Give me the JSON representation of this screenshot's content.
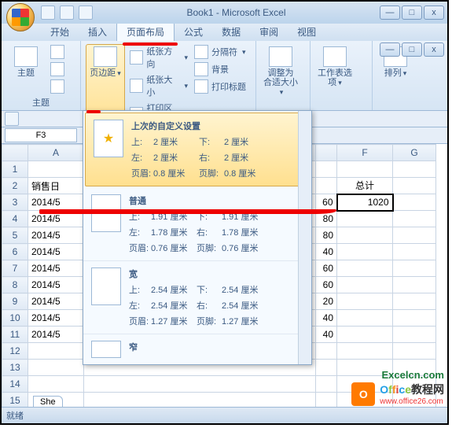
{
  "window": {
    "title": "Book1 - Microsoft Excel",
    "min": "—",
    "max": "□",
    "close": "x"
  },
  "tabs": {
    "home": "开始",
    "insert": "插入",
    "pagelayout": "页面布局",
    "formulas": "公式",
    "data": "数据",
    "review": "审阅",
    "view": "视图"
  },
  "ribbon": {
    "themes": {
      "label": "主题",
      "btn": "主题"
    },
    "margins": {
      "btn": "页边距"
    },
    "orient": "纸张方向",
    "size": "纸张大小",
    "printarea": "打印区域",
    "breaks": "分隔符",
    "background": "背景",
    "titles": "打印标题",
    "scale": {
      "btn": "调整为\n合适大小"
    },
    "sheetopts": {
      "btn": "工作表选项"
    },
    "arrange": {
      "btn": "排列"
    }
  },
  "namebox": "F3",
  "columns": {
    "A": "A",
    "F": "F",
    "G": "G"
  },
  "rows": [
    "1",
    "2",
    "3",
    "4",
    "5",
    "6",
    "7",
    "8",
    "9",
    "10",
    "11",
    "12",
    "13",
    "14",
    "15"
  ],
  "cells": {
    "A2": "销售日",
    "A3": "2014/5",
    "A4": "2014/5",
    "A5": "2014/5",
    "A6": "2014/5",
    "A7": "2014/5",
    "A8": "2014/5",
    "A9": "2014/5",
    "A10": "2014/5",
    "A11": "2014/5",
    "F2": "总计",
    "F3": "1020"
  },
  "gutter": {
    "r3": "60",
    "r4": "80",
    "r5": "80",
    "r6": "40",
    "r7": "60",
    "r8": "60",
    "r9": "20",
    "r10": "40",
    "r11": "40"
  },
  "dropdown": {
    "last": {
      "title": "上次的自定义设置",
      "top_l": "上:",
      "top_v": "2 厘米",
      "bottom_l": "下:",
      "bottom_v": "2 厘米",
      "left_l": "左:",
      "left_v": "2 厘米",
      "right_l": "右:",
      "right_v": "2 厘米",
      "hdr_l": "页眉:",
      "hdr_v": "0.8 厘米",
      "ftr_l": "页脚:",
      "ftr_v": "0.8 厘米"
    },
    "normal": {
      "title": "普通",
      "top_l": "上:",
      "top_v": "1.91 厘米",
      "bottom_l": "下:",
      "bottom_v": "1.91 厘米",
      "left_l": "左:",
      "left_v": "1.78 厘米",
      "right_l": "右:",
      "right_v": "1.78 厘米",
      "hdr_l": "页眉:",
      "hdr_v": "0.76 厘米",
      "ftr_l": "页脚:",
      "ftr_v": "0.76 厘米"
    },
    "wide": {
      "title": "宽",
      "top_l": "上:",
      "top_v": "2.54 厘米",
      "bottom_l": "下:",
      "bottom_v": "2.54 厘米",
      "left_l": "左:",
      "left_v": "2.54 厘米",
      "right_l": "右:",
      "right_v": "2.54 厘米",
      "hdr_l": "页眉:",
      "hdr_v": "1.27 厘米",
      "ftr_l": "页脚:",
      "ftr_v": "1.27 厘米"
    },
    "narrow": {
      "title": "窄"
    }
  },
  "sheet": "She",
  "status": "就绪",
  "wm": {
    "brand": "Office教程网",
    "url": "www.office26.com",
    "brand2": "Excelcn.com"
  }
}
